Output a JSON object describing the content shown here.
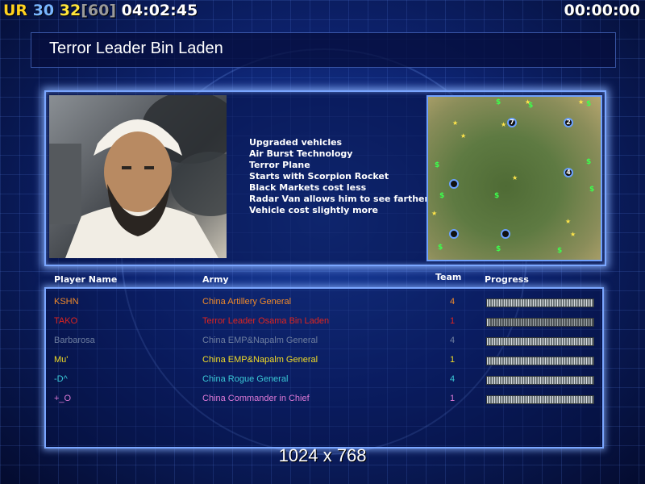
{
  "hud": {
    "ur_label": "UR",
    "ur_color": "#ffd21f",
    "num1": "30",
    "num1_color": "#79b6ff",
    "num2": "32",
    "num2_color": "#ffe53a",
    "bracket_value": "[60]",
    "bracket_color": "#9a9a9a",
    "clock": "04:02:45",
    "timer": "00:00:00"
  },
  "header": {
    "title": "Terror Leader Bin Laden"
  },
  "bonuses": [
    "Upgraded vehicles",
    "Air Burst Technology",
    "Terror Plane",
    "Starts with Scorpion Rocket",
    "Black Markets cost less",
    "Radar Van allows him to see farther",
    "Vehicle cost slightly more"
  ],
  "minimap": {
    "markers": [
      {
        "label": "7"
      },
      {
        "label": "2"
      },
      {
        "label": "4"
      },
      {
        "label": ""
      },
      {
        "label": ""
      },
      {
        "label": ""
      }
    ]
  },
  "columns": {
    "player": "Player Name",
    "army": "Army",
    "team": "Team",
    "progress": "Progress"
  },
  "players": [
    {
      "name": "KSHN",
      "army": "China Artillery General",
      "team": "4",
      "color": "#f08a2a",
      "progress": 1.0
    },
    {
      "name": "TAKO",
      "army": "Terror Leader Osama Bin Laden",
      "team": "1",
      "color": "#e2241e",
      "progress": 0.02
    },
    {
      "name": "Barbarosa",
      "army": "China EMP&Napalm General",
      "team": "4",
      "color": "#6f7fa0",
      "progress": 1.0
    },
    {
      "name": "Mu'",
      "army": "China EMP&Napalm General",
      "team": "1",
      "color": "#f2dc26",
      "progress": 1.0
    },
    {
      "name": "-D^",
      "army": "China Rogue General",
      "team": "4",
      "color": "#3ac8d6",
      "progress": 1.0
    },
    {
      "name": "+_O",
      "army": "China Commander in Chief",
      "team": "1",
      "color": "#e07ad8",
      "progress": 1.0
    }
  ],
  "resolution": "1024 x 768"
}
